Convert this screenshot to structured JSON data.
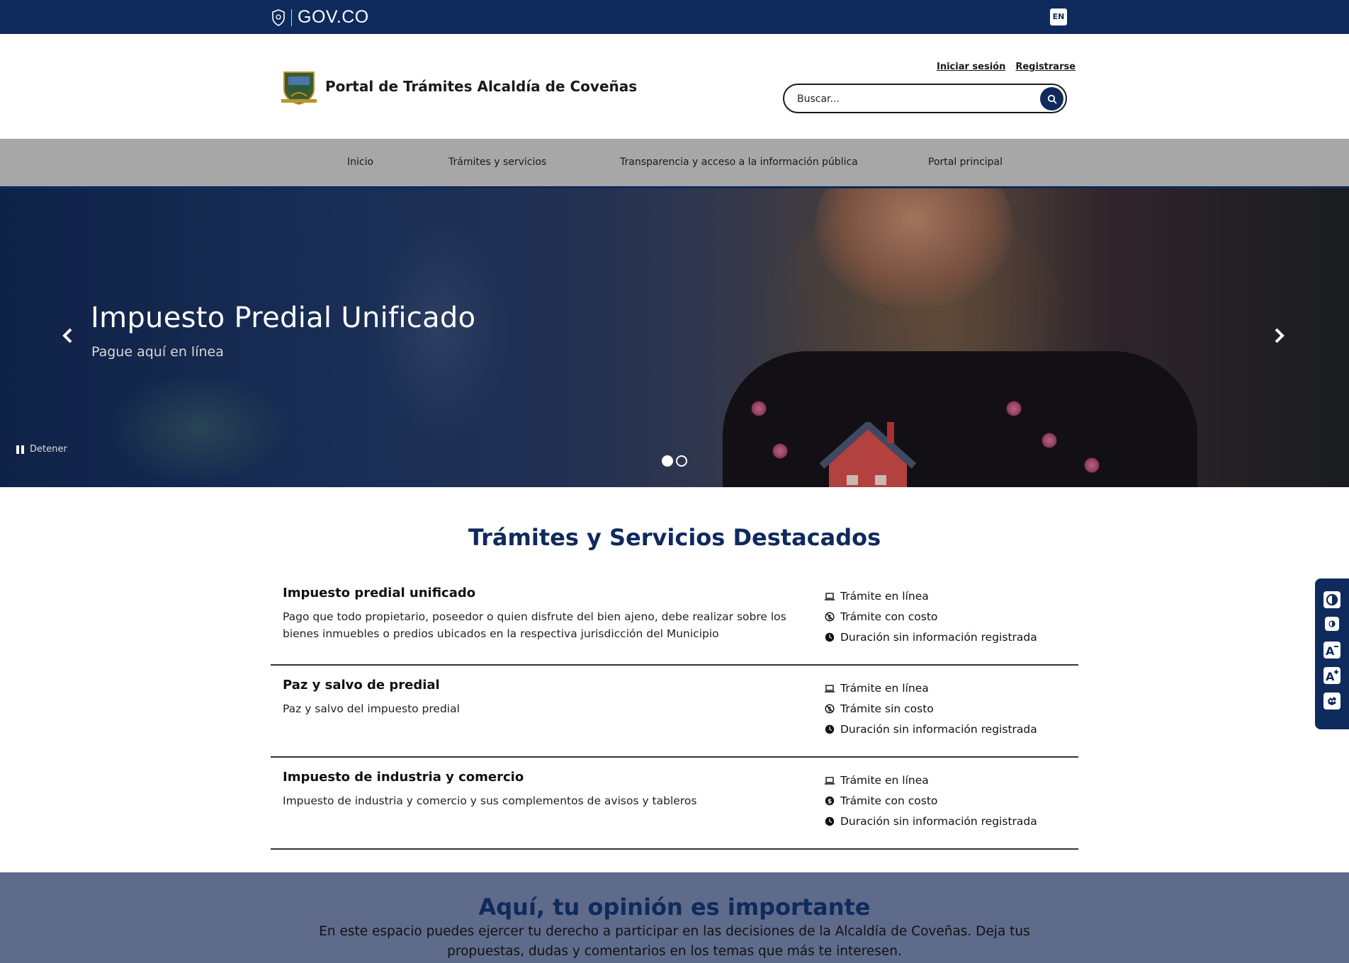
{
  "govbar": {
    "logo_text": "GOV.CO",
    "lang_label": "EN"
  },
  "header": {
    "title": "Portal de Trámites Alcaldía de Coveñas",
    "login_label": "Iniciar sesión",
    "register_label": "Registrarse",
    "search_placeholder": "Buscar..."
  },
  "nav": {
    "items": [
      {
        "label": "Inicio"
      },
      {
        "label": "Trámites y servicios"
      },
      {
        "label": "Transparencia y acceso a la información pública"
      },
      {
        "label": "Portal principal"
      }
    ]
  },
  "hero": {
    "title": "Impuesto Predial Unificado",
    "subtitle": "Pague aquí en línea",
    "pause_label": "Detener",
    "slides_count": 2,
    "active_slide": 1
  },
  "featured": {
    "title": "Trámites y Servicios Destacados",
    "items": [
      {
        "name": "Impuesto predial unificado",
        "description": "Pago que todo propietario, poseedor o quien disfrute del bien ajeno, debe realizar sobre los bienes inmuebles o predios ubicados en la respectiva jurisdicción del Municipio",
        "tags": [
          {
            "icon": "laptop-icon",
            "label": "Trámite en línea"
          },
          {
            "icon": "no-cost-icon",
            "label": "Trámite con costo"
          },
          {
            "icon": "clock-icon",
            "label": "Duración sin información registrada"
          }
        ]
      },
      {
        "name": "Paz y salvo de predial",
        "description": "Paz y salvo del impuesto predial",
        "tags": [
          {
            "icon": "laptop-icon",
            "label": "Trámite en línea"
          },
          {
            "icon": "no-cost-icon",
            "label": "Trámite sin costo"
          },
          {
            "icon": "clock-icon",
            "label": "Duración sin información registrada"
          }
        ]
      },
      {
        "name": "Impuesto de industria y comercio",
        "description": "Impuesto de industria y comercio y sus complementos de avisos y tableros",
        "tags": [
          {
            "icon": "laptop-icon",
            "label": "Trámite en línea"
          },
          {
            "icon": "coin-icon",
            "label": "Trámite con costo"
          },
          {
            "icon": "clock-icon",
            "label": "Duración sin información registrada"
          }
        ]
      }
    ]
  },
  "opinion": {
    "title": "Aquí, tu opinión es importante",
    "text": "En este espacio puedes ejercer tu derecho a participar en las decisiones de la Alcaldía de Coveñas. Deja tus propuestas, dudas y comentarios en los temas que más te interesen."
  },
  "colors": {
    "brand": "#0f2a5c",
    "nav_bg": "#a7a7a7",
    "opinion_bg": "#5f6b8a"
  }
}
